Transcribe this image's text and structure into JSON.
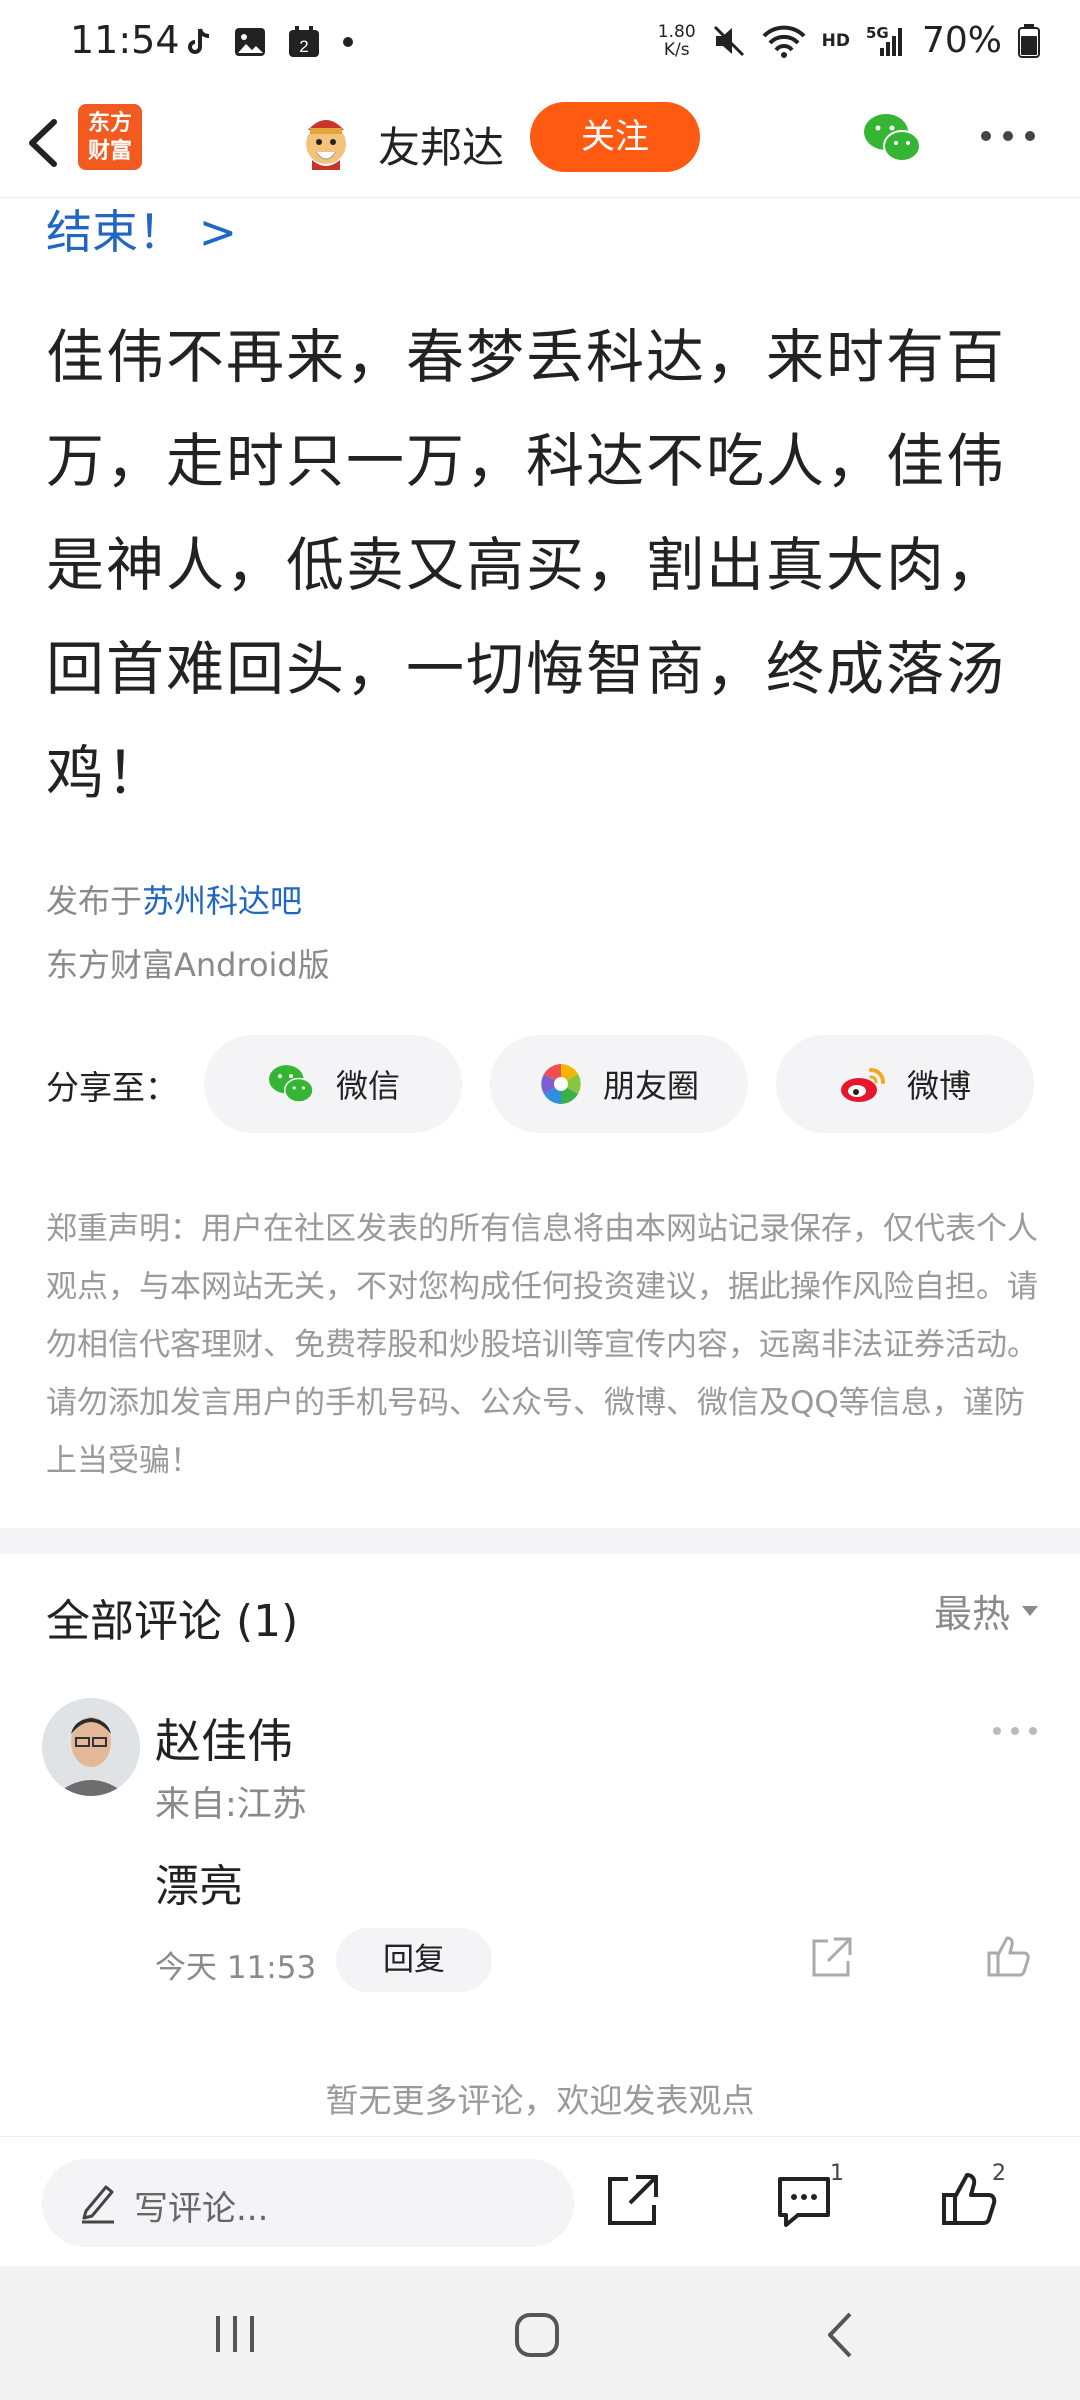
{
  "status_bar": {
    "time": "11:54",
    "notification_badge": "2",
    "net_speed_value": "1.80",
    "net_speed_unit": "K/s",
    "hd_label": "HD",
    "network_label": "5G",
    "battery": "70%",
    "icons": [
      "tiktok-icon",
      "gallery-icon",
      "calendar-icon",
      "dot-icon",
      "mute-icon",
      "wifi-icon",
      "signal-icon",
      "battery-icon"
    ]
  },
  "header": {
    "app_logo_line1": "东方",
    "app_logo_line2": "财富",
    "author_name": "友邦达",
    "follow_label": "关注",
    "accent_color": "#ff5a12"
  },
  "article": {
    "link_tail": "结束！ >",
    "body": "佳伟不再来，春梦丢科达，来时有百万，走时只一万，科达不吃人，佳伟是神人，低卖又高买，割出真大肉，回首难回头，一切悔智商，终成落汤鸡！",
    "published_prefix": "发布于",
    "bar_name": "苏州科达吧",
    "client": "东方财富Android版"
  },
  "share": {
    "label": "分享至：",
    "targets": [
      {
        "label": "微信",
        "icon": "wechat-icon"
      },
      {
        "label": "朋友圈",
        "icon": "moments-icon"
      },
      {
        "label": "微博",
        "icon": "weibo-icon"
      }
    ]
  },
  "disclaimer": "郑重声明：用户在社区发表的所有信息将由本网站记录保存，仅代表个人观点，与本网站无关，不对您构成任何投资建议，据此操作风险自担。请勿相信代客理财、免费荐股和炒股培训等宣传内容，远离非法证券活动。请勿添加发言用户的手机号码、公众号、微博、微信及QQ等信息，谨防上当受骗！",
  "comments": {
    "title": "全部评论 (1)",
    "sort": "最热",
    "items": [
      {
        "user": "赵佳伟",
        "location": "来自:江苏",
        "text": "漂亮",
        "time": "今天 11:53",
        "reply_label": "回复"
      }
    ],
    "no_more": "暂无更多评论，欢迎发表观点"
  },
  "action_bar": {
    "placeholder": "写评论...",
    "comment_count": "1",
    "like_count": "2"
  }
}
